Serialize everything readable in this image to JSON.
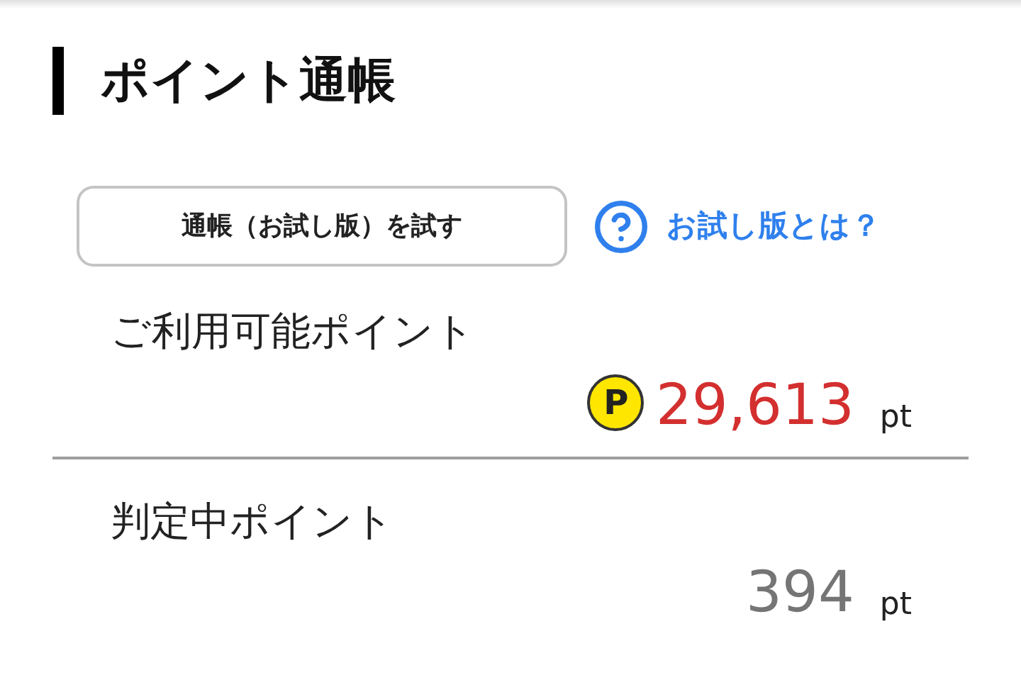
{
  "heading": "ポイント通帳",
  "trial_button": "通帳（お試し版）を試す",
  "help_link": "お試し版とは？",
  "points": [
    {
      "kind": "available",
      "label": "ご利用可能ポイント",
      "coin_symbol": "P",
      "value": "29,613",
      "unit": "pt"
    },
    {
      "kind": "pending",
      "label": "判定中ポイント",
      "value": "394",
      "unit": "pt"
    }
  ]
}
